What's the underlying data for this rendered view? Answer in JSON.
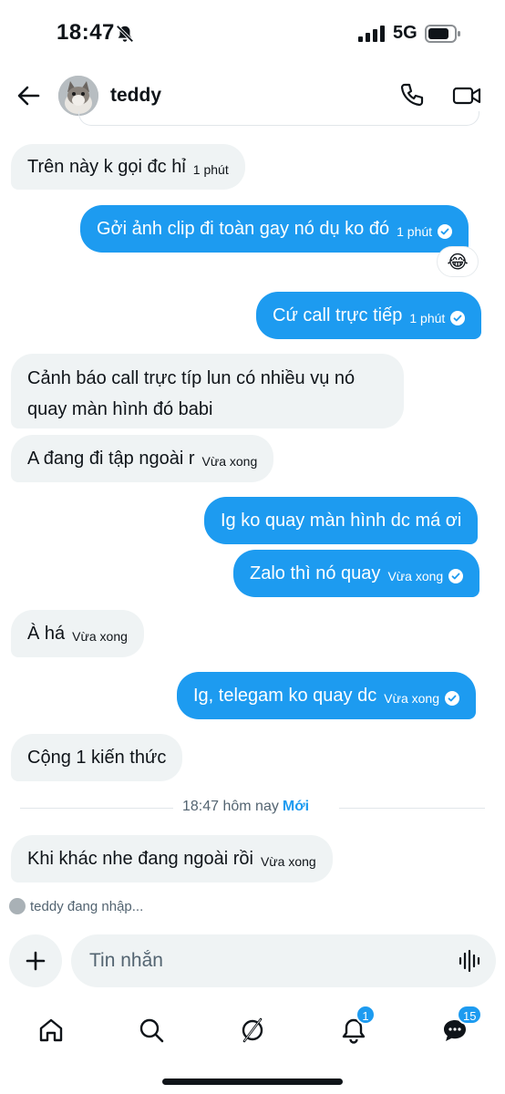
{
  "status_bar": {
    "time": "18:47",
    "network": "5G",
    "icons": [
      "bell-slash-icon",
      "signal-bars-icon",
      "battery-icon"
    ]
  },
  "header": {
    "contact_name": "teddy",
    "icons": [
      "back-arrow-icon",
      "phone-icon",
      "video-camera-icon"
    ]
  },
  "messages": [
    {
      "side": "in",
      "text": "Trên này k gọi đc hỉ",
      "time": "1 phút"
    },
    {
      "side": "out",
      "text": "Gởi ảnh clip đi toàn gay nó dụ ko đó",
      "time": "1 phút",
      "read": true,
      "reaction": "😂"
    },
    {
      "side": "out",
      "text": "Cứ call trực tiếp",
      "time": "1 phút",
      "read": true
    },
    {
      "side": "in",
      "text": "Cảnh báo call trực típ lun có nhiều vụ nó quay màn hình đó babi",
      "time": ""
    },
    {
      "side": "in",
      "text": "A đang đi tập ngoài r",
      "time": "Vừa xong"
    },
    {
      "side": "out",
      "text": "Ig ko quay màn hình dc má ơi",
      "time": ""
    },
    {
      "side": "out",
      "text": "Zalo thì nó quay",
      "time": "Vừa xong",
      "read": true
    },
    {
      "side": "in",
      "text": "À há",
      "time": "Vừa xong"
    },
    {
      "side": "out",
      "text": "Ig, telegam ko quay dc",
      "time": "Vừa xong",
      "read": true
    },
    {
      "side": "in",
      "text": "Cộng 1 kiến thức",
      "time": ""
    },
    {
      "side": "in",
      "text": "Khi khác nhe đang ngoài rồi",
      "time": "Vừa xong"
    }
  ],
  "divider": {
    "time": "18:47 hôm nay",
    "new_label": "Mới"
  },
  "typing_indicator": "teddy đang nhập...",
  "composer": {
    "placeholder": "Tin nhắn"
  },
  "bottom_nav": {
    "items": [
      {
        "name": "home",
        "icon": "home-icon"
      },
      {
        "name": "search",
        "icon": "search-icon"
      },
      {
        "name": "grok",
        "icon": "grok-icon"
      },
      {
        "name": "notifications",
        "icon": "bell-icon",
        "badge": "1"
      },
      {
        "name": "messages",
        "icon": "messages-icon",
        "badge": "15"
      }
    ]
  },
  "colors": {
    "accent": "#1d9bf0",
    "incoming_bubble": "#eff3f4",
    "text": "#0f1419",
    "muted": "#536471"
  }
}
